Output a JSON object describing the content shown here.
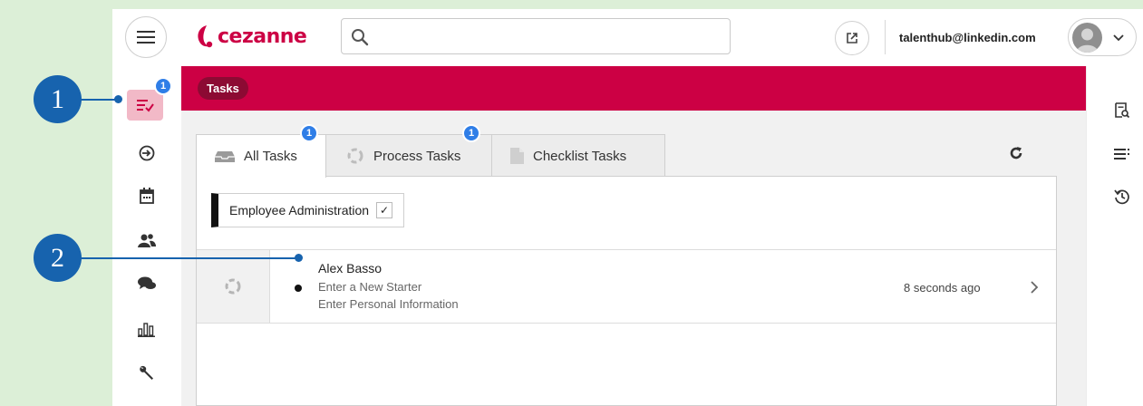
{
  "header": {
    "logo_text": "cezanne",
    "search_placeholder": "",
    "user_email": "talenthub@linkedin.com"
  },
  "left_nav": {
    "items": [
      {
        "icon": "tasks-icon",
        "badge": "1",
        "active": true
      },
      {
        "icon": "process-icon"
      },
      {
        "icon": "calendar-icon"
      },
      {
        "icon": "people-icon"
      },
      {
        "icon": "chat-icon"
      },
      {
        "icon": "bar-chart-icon"
      },
      {
        "icon": "wrench-icon"
      }
    ]
  },
  "right_rail": {
    "items": [
      {
        "icon": "document-search-icon"
      },
      {
        "icon": "list-icon"
      },
      {
        "icon": "history-icon"
      }
    ]
  },
  "banner": {
    "breadcrumb": "Tasks"
  },
  "tabs": [
    {
      "label": "All Tasks",
      "badge": "1",
      "active": true,
      "icon": "inbox-icon"
    },
    {
      "label": "Process Tasks",
      "badge": "1",
      "icon": "spinner-icon"
    },
    {
      "label": "Checklist Tasks",
      "icon": "document-icon"
    }
  ],
  "filter": {
    "label": "Employee Administration",
    "checked": true,
    "check_glyph": "✓"
  },
  "task": {
    "name": "Alex Basso",
    "process": "Enter a New Starter",
    "step": "Enter Personal Information",
    "time": "8 seconds ago"
  },
  "callouts": [
    "1",
    "2"
  ],
  "colors": {
    "brand": "#cc0044",
    "badge": "#2f7ee7",
    "callout": "#1763ae",
    "background": "#dcefd7"
  }
}
